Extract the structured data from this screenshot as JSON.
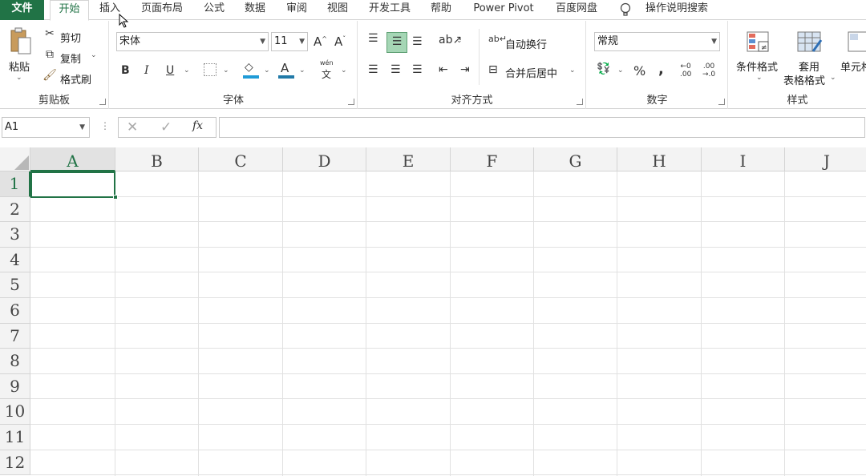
{
  "tabs": [
    "文件",
    "开始",
    "插入",
    "页面布局",
    "公式",
    "数据",
    "审阅",
    "视图",
    "开发工具",
    "帮助",
    "Power Pivot",
    "百度网盘"
  ],
  "tell_me": "操作说明搜索",
  "clipboard": {
    "paste": "粘贴",
    "cut": "剪切",
    "copy": "复制",
    "format_painter": "格式刷",
    "label": "剪贴板"
  },
  "font": {
    "name": "宋体",
    "size": "11",
    "bold": "B",
    "italic": "I",
    "underline": "U",
    "grow": "A",
    "shrink": "A",
    "font_color": "A",
    "phonetic_top": "wén",
    "phonetic": "文",
    "label": "字体"
  },
  "alignment": {
    "wrap": "自动换行",
    "merge": "合并后居中",
    "label": "对齐方式"
  },
  "number": {
    "format": "常规",
    "percent": "%",
    "comma": ",",
    "inc_decimal": ".00",
    "dec_decimal": ".0",
    "label": "数字"
  },
  "styles": {
    "conditional": "条件格式",
    "table_format_1": "套用",
    "table_format_2": "表格格式",
    "cell_styles": "单元格",
    "label": "样式"
  },
  "namebox": "A1",
  "fx": "fx",
  "columns": [
    "A",
    "B",
    "C",
    "D",
    "E",
    "F",
    "G",
    "H",
    "I",
    "J"
  ],
  "rows": [
    "1",
    "2",
    "3",
    "4",
    "5",
    "6",
    "7",
    "8",
    "9",
    "10",
    "11",
    "12"
  ],
  "colors": {
    "accent": "#217346",
    "fill_bar": "#1f9bd7",
    "font_bar": "#c00000"
  }
}
